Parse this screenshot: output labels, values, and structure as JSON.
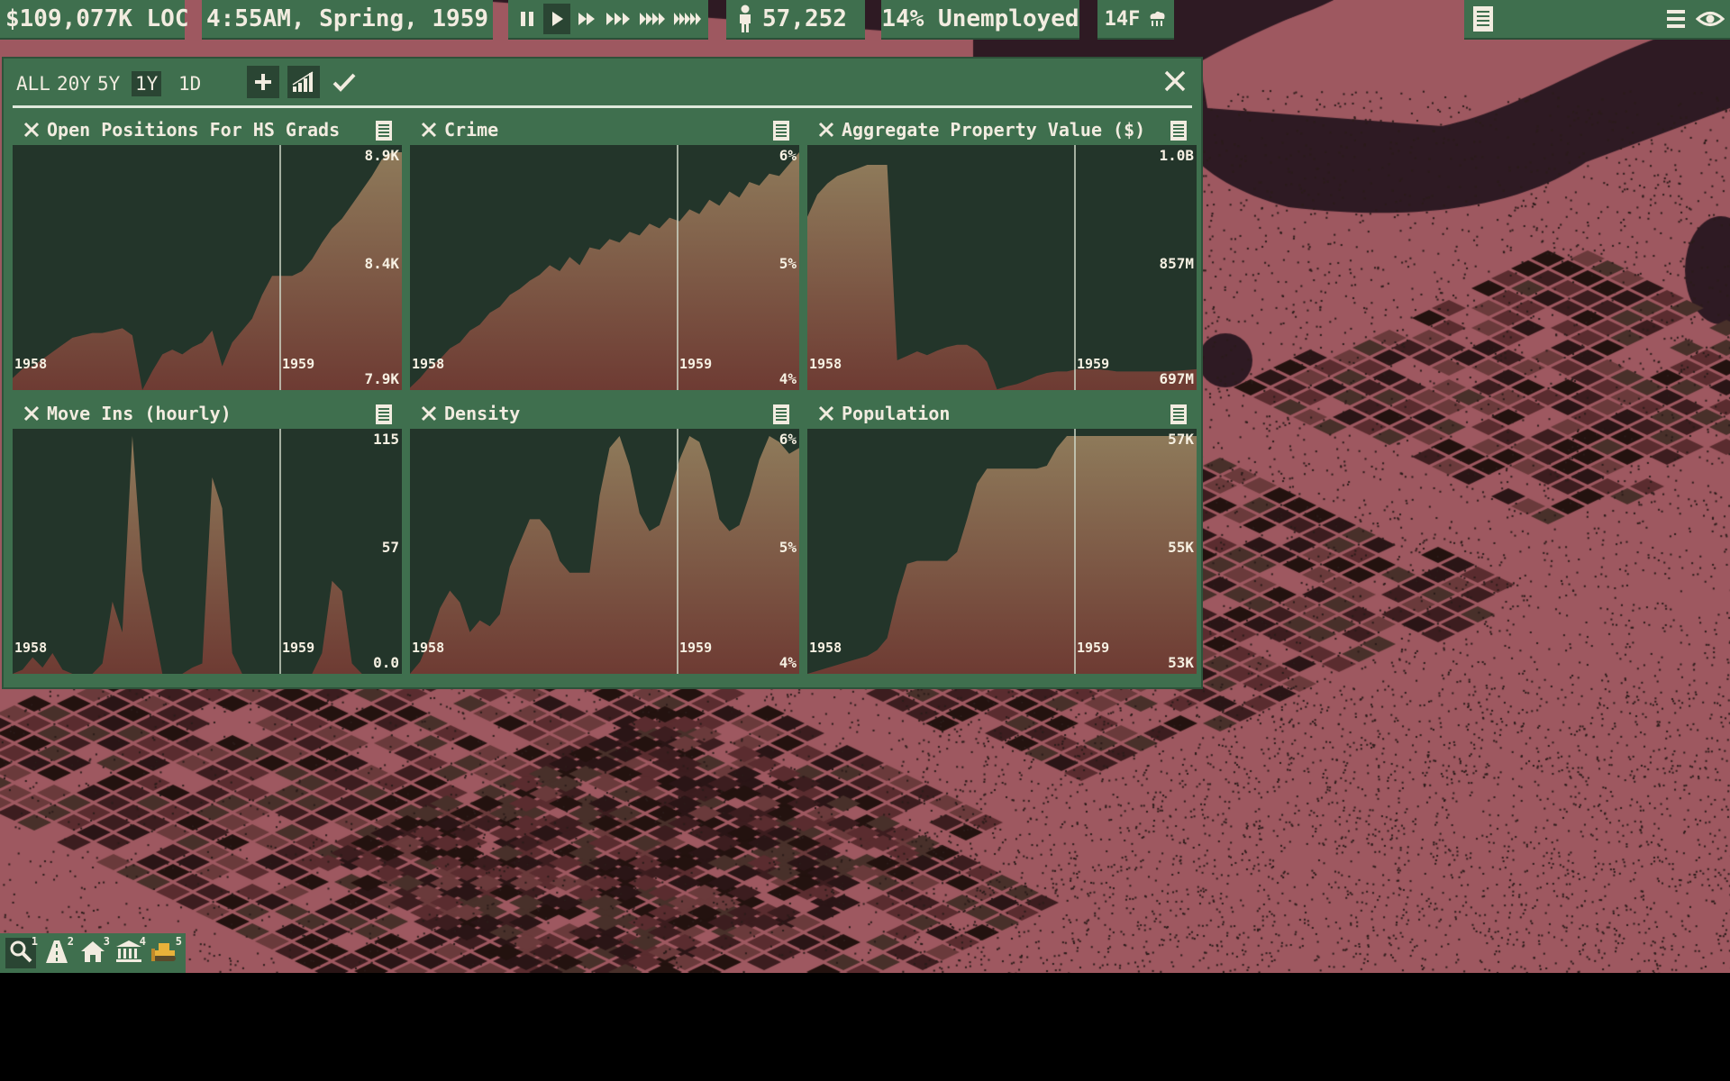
{
  "hud": {
    "money": "$109,077K LOC",
    "datetime": "4:55AM, Spring, 1959",
    "population": "57,252",
    "unemployment": "14% Unemployed",
    "temperature": "14F"
  },
  "speed_controls": [
    {
      "name": "pause-button",
      "icon": "pause-icon"
    },
    {
      "name": "play-button",
      "icon": "play-icon",
      "active": true
    },
    {
      "name": "speed-2-button",
      "icon": "fast-forward-icon"
    },
    {
      "name": "speed-3-button",
      "icon": "fast-forward-3-icon"
    },
    {
      "name": "speed-4-button",
      "icon": "fast-forward-4-icon"
    },
    {
      "name": "speed-5-button",
      "icon": "fast-forward-5-icon"
    }
  ],
  "panel": {
    "ranges": [
      {
        "label": "ALL",
        "active": false
      },
      {
        "label": "20Y",
        "active": false
      },
      {
        "label": "5Y",
        "active": false
      },
      {
        "label": "1Y",
        "active": true
      },
      {
        "label": "1D",
        "active": false
      }
    ],
    "tools": [
      "add-icon",
      "bar-chart-icon",
      "check-icon"
    ]
  },
  "charts": [
    {
      "title": "Open Positions For HS Grads",
      "x_ticks": [
        "1958",
        "1959"
      ],
      "y_labels": [
        "8.9K",
        "8.4K",
        "7.9K"
      ],
      "ylim": [
        7.9,
        8.9
      ],
      "values": [
        7.95,
        7.99,
        8.0,
        8.03,
        8.06,
        8.09,
        8.12,
        8.13,
        8.14,
        8.14,
        8.15,
        8.16,
        8.13,
        7.88,
        7.98,
        8.05,
        8.07,
        8.05,
        8.08,
        8.1,
        8.15,
        8.0,
        8.1,
        8.15,
        8.2,
        8.3,
        8.38,
        8.38,
        8.38,
        8.4,
        8.45,
        8.52,
        8.58,
        8.62,
        8.68,
        8.74,
        8.8,
        8.87,
        8.9,
        8.92
      ]
    },
    {
      "title": "Crime",
      "x_ticks": [
        "1958",
        "1959"
      ],
      "y_labels": [
        "6%",
        "5%",
        "4%"
      ],
      "ylim": [
        4,
        6
      ],
      "values": [
        4.02,
        4.1,
        4.2,
        4.26,
        4.35,
        4.4,
        4.5,
        4.55,
        4.65,
        4.7,
        4.8,
        4.85,
        4.92,
        4.97,
        5.05,
        5.0,
        5.12,
        5.05,
        5.2,
        5.18,
        5.27,
        5.24,
        5.33,
        5.3,
        5.4,
        5.36,
        5.45,
        5.42,
        5.52,
        5.48,
        5.6,
        5.55,
        5.67,
        5.62,
        5.75,
        5.72,
        5.82,
        5.8,
        5.9,
        6.0
      ]
    },
    {
      "title": "Aggregate Property Value ($)",
      "x_ticks": [
        "1958",
        "1959"
      ],
      "y_labels": [
        "1.0B",
        "857M",
        "697M"
      ],
      "ylim": [
        697,
        1017
      ],
      "values": [
        930,
        960,
        975,
        985,
        990,
        995,
        1000,
        1000,
        1000,
        737,
        743,
        749,
        744,
        750,
        755,
        758,
        758,
        750,
        735,
        698,
        702,
        705,
        710,
        716,
        720,
        722,
        722,
        725,
        725,
        725,
        724,
        722,
        722,
        722,
        722,
        722,
        722,
        723,
        724,
        725
      ]
    },
    {
      "title": "Move Ins (hourly)",
      "x_ticks": [
        "1958",
        "1959"
      ],
      "y_labels": [
        "115",
        "57",
        "0.0"
      ],
      "ylim": [
        0,
        115
      ],
      "values": [
        0,
        2,
        8,
        3,
        10,
        2,
        0,
        0,
        0,
        5,
        35,
        20,
        115,
        50,
        25,
        0,
        0,
        0,
        3,
        5,
        95,
        80,
        10,
        0,
        0,
        0,
        0,
        0,
        0,
        0,
        0,
        10,
        45,
        40,
        5,
        0,
        0,
        0,
        0,
        0
      ]
    },
    {
      "title": "Density",
      "x_ticks": [
        "1958",
        "1959"
      ],
      "y_labels": [
        "6%",
        "5%",
        "4%"
      ],
      "ylim": [
        4,
        6
      ],
      "values": [
        4.0,
        4.1,
        4.3,
        4.55,
        4.7,
        4.6,
        4.35,
        4.45,
        4.4,
        4.5,
        4.9,
        5.1,
        5.3,
        5.3,
        5.2,
        4.95,
        4.85,
        4.85,
        4.85,
        5.5,
        5.9,
        6.0,
        5.75,
        5.35,
        5.2,
        5.25,
        5.5,
        5.8,
        6.0,
        5.95,
        5.7,
        5.3,
        5.2,
        5.25,
        5.5,
        5.8,
        6.0,
        5.95,
        5.85,
        5.9
      ]
    },
    {
      "title": "Population",
      "x_ticks": [
        "1958",
        "1959"
      ],
      "y_labels": [
        "57K",
        "55K",
        "53K"
      ],
      "ylim": [
        53,
        57
      ],
      "values": [
        53.0,
        53.05,
        53.1,
        53.15,
        53.2,
        53.25,
        53.3,
        53.4,
        53.6,
        54.3,
        54.85,
        54.9,
        54.9,
        54.9,
        54.9,
        55.05,
        55.6,
        56.2,
        56.45,
        56.45,
        56.45,
        56.45,
        56.45,
        56.45,
        56.5,
        56.8,
        57.0,
        57.05,
        57.1,
        57.1,
        57.1,
        57.1,
        57.1,
        57.1,
        57.1,
        57.1,
        57.1,
        57.1,
        57.1,
        57.1
      ]
    }
  ],
  "bottom_tools": [
    {
      "name": "query-tool",
      "icon": "magnifier-icon",
      "num": "1",
      "active": true
    },
    {
      "name": "road-tool",
      "icon": "road-icon",
      "num": "2",
      "active": false
    },
    {
      "name": "zone-tool",
      "icon": "house-icon",
      "num": "3",
      "active": false
    },
    {
      "name": "building-tool",
      "icon": "government-icon",
      "num": "4",
      "active": false
    },
    {
      "name": "bulldozer-tool",
      "icon": "bulldozer-icon",
      "num": "5",
      "active": false
    }
  ],
  "colors": {
    "panel": "#3f6f4e",
    "chart_bg": "#23352a",
    "fill_top": "#8e7a5a",
    "fill_bottom": "#6e3b33",
    "terrain": "#a35c64",
    "water": "#2f1a24"
  }
}
